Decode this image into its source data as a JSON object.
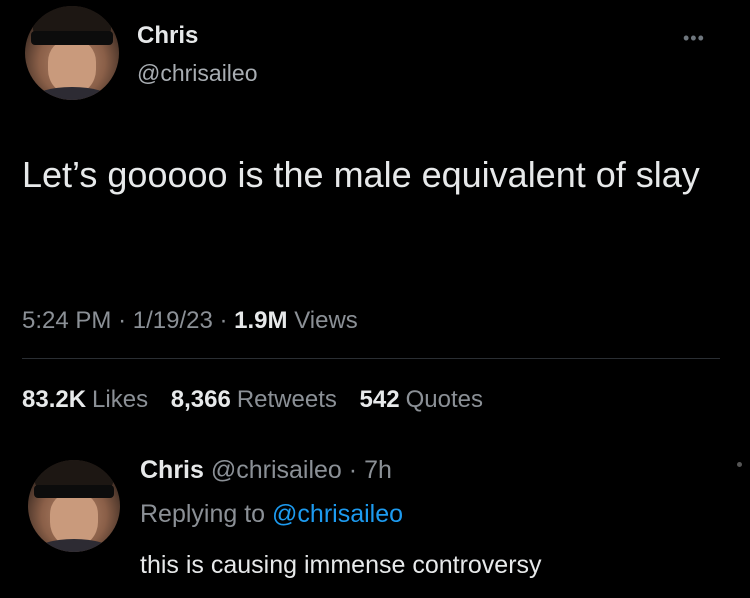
{
  "tweet": {
    "author": {
      "name": "Chris",
      "handle": "@chrisaileo"
    },
    "more_icon": "more-options-icon",
    "text": "Let’s gooooo is the male equivalent of slay",
    "meta": {
      "time": "5:24 PM",
      "separator": "·",
      "date": "1/19/23",
      "views_count": "1.9M",
      "views_label": "Views"
    },
    "stats": {
      "likes_count": "83.2K",
      "likes_label": "Likes",
      "retweets_count": "8,366",
      "retweets_label": "Retweets",
      "quotes_count": "542",
      "quotes_label": "Quotes"
    }
  },
  "reply": {
    "author": {
      "name": "Chris",
      "handle": "@chrisaileo"
    },
    "age": "· 7h",
    "replying_prefix": "Replying to",
    "replying_handle": "@chrisaileo",
    "text": "this is causing immense controversy"
  }
}
